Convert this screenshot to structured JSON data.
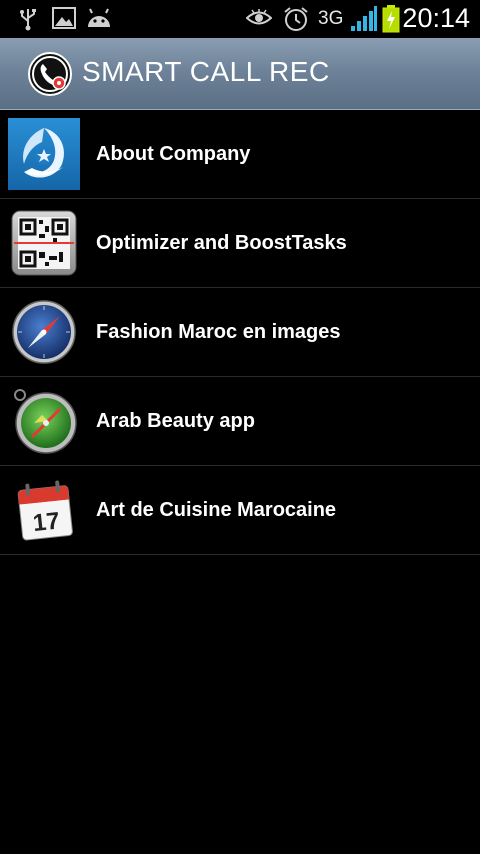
{
  "status_bar": {
    "icons_left": [
      "usb-icon",
      "image-icon",
      "android-icon"
    ],
    "icons_right": [
      "eye-icon",
      "alarm-icon",
      "signal-icon",
      "battery-charging-icon"
    ],
    "network": "3G",
    "time": "20:14"
  },
  "action_bar": {
    "icon": "phone-record-icon",
    "title": "SMART CALL REC",
    "color": "#6e8399"
  },
  "items": [
    {
      "label": "About Company",
      "icon": "company-logo-icon"
    },
    {
      "label": "Optimizer and BoostTasks",
      "icon": "qr-scanner-icon"
    },
    {
      "label": "Fashion Maroc en images",
      "icon": "compass-icon"
    },
    {
      "label": "Arab Beauty app",
      "icon": "green-stopwatch-icon"
    },
    {
      "label": "Art de Cuisine Marocaine",
      "icon": "calendar-icon"
    }
  ]
}
